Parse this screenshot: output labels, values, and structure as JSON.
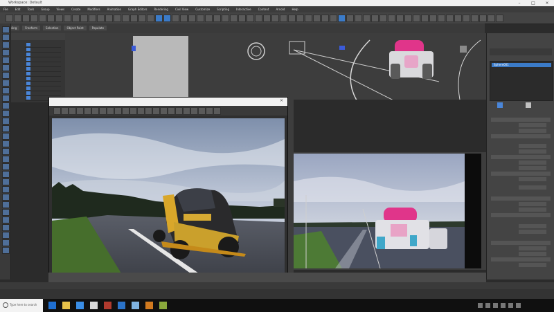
{
  "app": {
    "title": "Workspace: Default",
    "colors": {
      "accent": "#3b7bc8",
      "selection": "#4a86d9",
      "panel": "#444444"
    }
  },
  "menubar": [
    "File",
    "Edit",
    "Tools",
    "Group",
    "Views",
    "Create",
    "Modifiers",
    "Animation",
    "Graph Editors",
    "Rendering",
    "Civil View",
    "Customize",
    "Scripting",
    "Interactive",
    "Content",
    "Arnold",
    "Help"
  ],
  "ribbon": {
    "tabs": [
      "Modeling",
      "Freeform",
      "Selection",
      "Object Paint",
      "Populate"
    ]
  },
  "render_window": {
    "title": "",
    "image_description": "rendered car"
  },
  "command_panel": {
    "selected_item": "Sphere001"
  },
  "taskbar": {
    "search_placeholder": "Type here to search",
    "time": "",
    "date": ""
  }
}
